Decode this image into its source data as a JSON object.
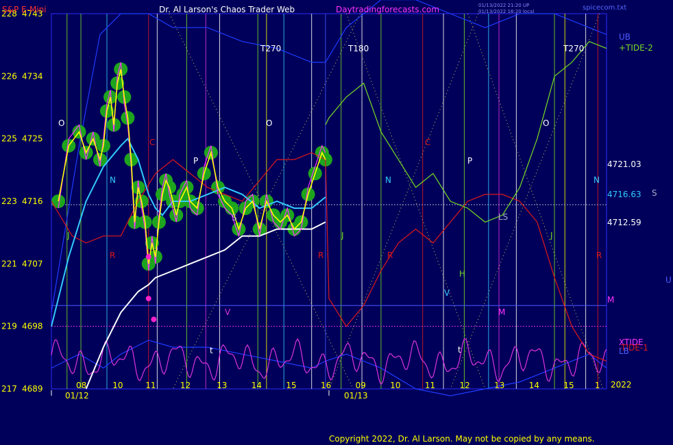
{
  "header": {
    "symbol": "S&P E-Mini",
    "title": "Dr. Al Larson's Chaos Trader Web",
    "site": "Daytradingforecasts.com",
    "stamp1": "01/13/2022 21:20 UP",
    "stamp2": "01/13/2022 16:20 local",
    "file": "spicecom.txt"
  },
  "footer": {
    "copyright": "Copyright 2022, Dr. Al Larson. May not be copied by any means."
  },
  "colors": {
    "background": "#00005a",
    "price_glow": "#1ea51e",
    "price": "#ffff00",
    "price_detail": "#ff33ff",
    "ma_fast": "#33ccff",
    "ma_slow": "#ffffff",
    "tide": "#77dd22",
    "envelope": "#1e3cff",
    "red_line": "#e01818",
    "xtide": "#dd33dd"
  },
  "chart_data": {
    "type": "line",
    "ylim": [
      4689,
      4743
    ],
    "y_ticks": [
      {
        "left": "228",
        "right": "4743",
        "value": 4743
      },
      {
        "left": "226",
        "right": "4734",
        "value": 4734
      },
      {
        "left": "225",
        "right": "4725",
        "value": 4725
      },
      {
        "left": "223",
        "right": "4716",
        "value": 4716
      },
      {
        "left": "221",
        "right": "4707",
        "value": 4707
      },
      {
        "left": "219",
        "right": "4698",
        "value": 4698
      },
      {
        "left": "217",
        "right": "4689",
        "value": 4689
      }
    ],
    "x_hours": [
      "08",
      "10",
      "11",
      "12",
      "13",
      "14",
      "15",
      "16",
      "09",
      "10",
      "11",
      "12",
      "13",
      "14",
      "15",
      "1"
    ],
    "x_dates": [
      "01/12",
      "01/13"
    ],
    "year": "2022",
    "right_labels": [
      {
        "text": "UB",
        "color": "#4a5aff"
      },
      {
        "text": "+TIDE-2",
        "color": "#77dd22"
      },
      {
        "text": "4721.03",
        "color": "#ffffff",
        "value": 4721.03
      },
      {
        "text": "4716.63",
        "color": "#33ccff",
        "value": 4716.63
      },
      {
        "text": "S",
        "color": "#aaaacc"
      },
      {
        "text": "4712.59",
        "color": "#ffffff",
        "value": 4712.59
      },
      {
        "text": "U",
        "color": "#4a5aff"
      },
      {
        "text": "M",
        "color": "#ff33ff"
      },
      {
        "text": "XTIDE",
        "color": "#ff33ff"
      },
      {
        "text": "-TIDE-1",
        "color": "#e01818"
      },
      {
        "text": "LB",
        "color": "#4a5aff"
      }
    ],
    "cycle_labels": [
      "T270",
      "T180",
      "T270"
    ],
    "markers": [
      {
        "text": "O",
        "color": "#ffffff"
      },
      {
        "text": "N",
        "color": "#33ccff"
      },
      {
        "text": "J",
        "color": "#77dd22"
      },
      {
        "text": "R",
        "color": "#e01818"
      },
      {
        "text": "C",
        "color": "#e01818"
      },
      {
        "text": "P",
        "color": "#ffffff"
      },
      {
        "text": "V",
        "color": "#dd33dd"
      },
      {
        "text": "S",
        "color": "#aaaacc"
      },
      {
        "text": "t",
        "color": "#ffffff"
      },
      {
        "text": "O",
        "color": "#ffffff"
      },
      {
        "text": "R",
        "color": "#e01818"
      },
      {
        "text": "N",
        "color": "#33ccff"
      },
      {
        "text": "J",
        "color": "#77dd22"
      },
      {
        "text": "R",
        "color": "#e01818"
      },
      {
        "text": "C",
        "color": "#e01818"
      },
      {
        "text": "P",
        "color": "#ffffff"
      },
      {
        "text": "H",
        "color": "#77dd22"
      },
      {
        "text": "V",
        "color": "#33ccff"
      },
      {
        "text": "t",
        "color": "#ffffff"
      },
      {
        "text": "M",
        "color": "#ff33ff"
      },
      {
        "text": "LS",
        "color": "#aaaacc"
      },
      {
        "text": "J",
        "color": "#77dd22"
      },
      {
        "text": "O",
        "color": "#ffffff"
      },
      {
        "text": "N",
        "color": "#33ccff"
      },
      {
        "text": "R",
        "color": "#e01818"
      }
    ],
    "series": [
      {
        "name": "price",
        "color": "#ffff00",
        "x": [
          0.2,
          0.5,
          0.8,
          1.0,
          1.2,
          1.4,
          1.5,
          1.6,
          1.7,
          1.8,
          1.9,
          2.0,
          2.1,
          2.2,
          2.3,
          2.4,
          2.5,
          2.6,
          2.7,
          2.8,
          2.9,
          3.0,
          3.1,
          3.2,
          3.3,
          3.4,
          3.5,
          3.6,
          3.7,
          3.8,
          3.9,
          4.0,
          4.2,
          4.4,
          4.6,
          4.8,
          5.0,
          5.2,
          5.4,
          5.6,
          5.8,
          6.0,
          6.2,
          6.4,
          6.6,
          6.8,
          7.0,
          7.2,
          7.4,
          7.6,
          7.8,
          7.9
        ],
        "values": [
          4716,
          4724,
          4726,
          4723,
          4725,
          4722,
          4724,
          4729,
          4731,
          4727,
          4733,
          4735,
          4731,
          4728,
          4722,
          4713,
          4718,
          4716,
          4713,
          4707,
          4710,
          4708,
          4713,
          4717,
          4719,
          4718,
          4716,
          4714,
          4716,
          4717,
          4718,
          4716,
          4715,
          4720,
          4723,
          4718,
          4716,
          4715,
          4712,
          4715,
          4716,
          4712,
          4716,
          4714,
          4713,
          4714,
          4712,
          4713,
          4717,
          4720,
          4723,
          4722
        ]
      },
      {
        "name": "",
        "color": "#ff33ff",
        "x": [
          0.2,
          0.5,
          0.8,
          1.0,
          1.2,
          1.4,
          1.5,
          1.6,
          1.7,
          1.8,
          1.9,
          2.0,
          2.1,
          2.2,
          2.3,
          2.4,
          2.5,
          2.6,
          2.7,
          2.8,
          2.9,
          3.0,
          3.1,
          3.2,
          3.3,
          3.4,
          3.5,
          3.6,
          3.7,
          3.8,
          3.9,
          4.0,
          4.2,
          4.4,
          4.6,
          4.8,
          5.0,
          5.2,
          5.4,
          5.6,
          5.8,
          6.0,
          6.2,
          6.4,
          6.6,
          6.8,
          7.0,
          7.2,
          7.4,
          7.6,
          7.8,
          7.9
        ],
        "values": [
          4715,
          4725,
          4727,
          4722,
          4726,
          4721,
          4725,
          4730,
          4732,
          4726,
          4734,
          4736,
          4730,
          4727,
          4721,
          4712,
          4719,
          4715,
          4712,
          4706,
          4711,
          4707,
          4714,
          4718,
          4720,
          4717,
          4715,
          4713,
          4717,
          4718,
          4719,
          4715,
          4714,
          4721,
          4724,
          4717,
          4715,
          4714,
          4711,
          4716,
          4717,
          4711,
          4717,
          4713,
          4712,
          4715,
          4711,
          4712,
          4718,
          4721,
          4724,
          4723
        ]
      },
      {
        "name": "",
        "color": "#33ccff",
        "x": [
          0.0,
          0.5,
          1.0,
          1.5,
          2.0,
          2.2,
          2.5,
          2.8,
          3.0,
          3.2,
          3.5,
          4.0,
          4.5,
          5.0,
          5.5,
          6.0,
          6.5,
          7.0,
          7.5,
          7.9
        ],
        "values": [
          4698,
          4708,
          4716,
          4721,
          4724,
          4725,
          4722,
          4717,
          4715,
          4714,
          4716,
          4716,
          4717,
          4718,
          4717,
          4715,
          4716,
          4715,
          4715,
          4716.6
        ]
      },
      {
        "name": "",
        "color": "#ffffff",
        "x": [
          1.0,
          1.5,
          2.0,
          2.5,
          2.8,
          3.0,
          3.5,
          4.0,
          4.5,
          5.0,
          5.5,
          6.0,
          6.5,
          7.0,
          7.5,
          7.9
        ],
        "values": [
          4689,
          4695,
          4700,
          4703,
          4704,
          4705,
          4706,
          4707,
          4708,
          4709,
          4711,
          4711,
          4712,
          4712,
          4712,
          4713
        ]
      },
      {
        "name": "+TIDE-2",
        "color": "#77dd22",
        "x": [
          7.9,
          8.0,
          8.5,
          9.0,
          9.5,
          10.0,
          10.5,
          11.0,
          11.5,
          12.0,
          12.5,
          13.0,
          13.5,
          14.0,
          14.5,
          15.0,
          15.5,
          16.0
        ],
        "values": [
          4727,
          4728,
          4731,
          4733,
          4726,
          4722,
          4718,
          4720,
          4716,
          4715,
          4713,
          4714,
          4718,
          4725,
          4734,
          4736,
          4739,
          4738
        ]
      },
      {
        "name": "-TIDE-1",
        "color": "#e01818",
        "x": [
          0.0,
          0.6,
          1.0,
          1.5,
          2.0,
          2.5,
          3.0,
          3.5,
          4.0,
          4.5,
          5.0,
          5.5,
          6.0,
          6.5,
          7.0,
          7.5,
          7.9,
          8.0,
          8.5,
          9.0,
          9.5,
          10.0,
          10.5,
          11.0,
          11.5,
          12.0,
          12.5,
          13.0,
          13.5,
          14.0,
          14.5,
          15.0,
          15.5,
          16.0
        ],
        "values": [
          4716,
          4711,
          4710,
          4711,
          4711,
          4716,
          4720,
          4722,
          4720,
          4718,
          4717,
          4716,
          4719,
          4722,
          4722,
          4723,
          4722,
          4702,
          4698,
          4701,
          4706,
          4710,
          4712,
          4710,
          4713,
          4716,
          4717,
          4717,
          4716,
          4713,
          4705,
          4698,
          4694,
          4693
        ]
      }
    ],
    "xtide": {
      "name": "XTIDE",
      "color": "#dd33dd"
    }
  }
}
